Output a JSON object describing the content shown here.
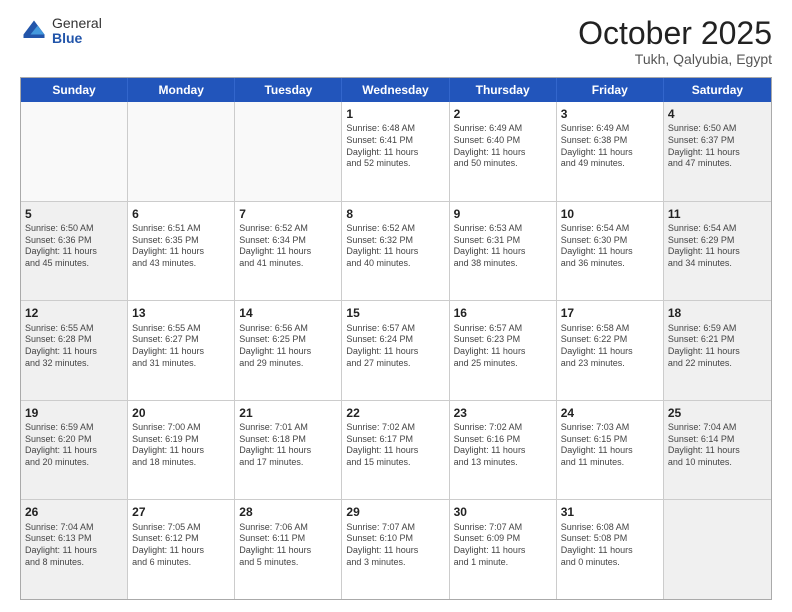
{
  "header": {
    "logo_general": "General",
    "logo_blue": "Blue",
    "month": "October 2025",
    "location": "Tukh, Qalyubia, Egypt"
  },
  "weekdays": [
    "Sunday",
    "Monday",
    "Tuesday",
    "Wednesday",
    "Thursday",
    "Friday",
    "Saturday"
  ],
  "rows": [
    [
      {
        "day": "",
        "text": "",
        "empty": true
      },
      {
        "day": "",
        "text": "",
        "empty": true
      },
      {
        "day": "",
        "text": "",
        "empty": true
      },
      {
        "day": "1",
        "text": "Sunrise: 6:48 AM\nSunset: 6:41 PM\nDaylight: 11 hours\nand 52 minutes.",
        "empty": false
      },
      {
        "day": "2",
        "text": "Sunrise: 6:49 AM\nSunset: 6:40 PM\nDaylight: 11 hours\nand 50 minutes.",
        "empty": false
      },
      {
        "day": "3",
        "text": "Sunrise: 6:49 AM\nSunset: 6:38 PM\nDaylight: 11 hours\nand 49 minutes.",
        "empty": false
      },
      {
        "day": "4",
        "text": "Sunrise: 6:50 AM\nSunset: 6:37 PM\nDaylight: 11 hours\nand 47 minutes.",
        "empty": false,
        "shaded": true
      }
    ],
    [
      {
        "day": "5",
        "text": "Sunrise: 6:50 AM\nSunset: 6:36 PM\nDaylight: 11 hours\nand 45 minutes.",
        "empty": false,
        "shaded": true
      },
      {
        "day": "6",
        "text": "Sunrise: 6:51 AM\nSunset: 6:35 PM\nDaylight: 11 hours\nand 43 minutes.",
        "empty": false
      },
      {
        "day": "7",
        "text": "Sunrise: 6:52 AM\nSunset: 6:34 PM\nDaylight: 11 hours\nand 41 minutes.",
        "empty": false
      },
      {
        "day": "8",
        "text": "Sunrise: 6:52 AM\nSunset: 6:32 PM\nDaylight: 11 hours\nand 40 minutes.",
        "empty": false
      },
      {
        "day": "9",
        "text": "Sunrise: 6:53 AM\nSunset: 6:31 PM\nDaylight: 11 hours\nand 38 minutes.",
        "empty": false
      },
      {
        "day": "10",
        "text": "Sunrise: 6:54 AM\nSunset: 6:30 PM\nDaylight: 11 hours\nand 36 minutes.",
        "empty": false
      },
      {
        "day": "11",
        "text": "Sunrise: 6:54 AM\nSunset: 6:29 PM\nDaylight: 11 hours\nand 34 minutes.",
        "empty": false,
        "shaded": true
      }
    ],
    [
      {
        "day": "12",
        "text": "Sunrise: 6:55 AM\nSunset: 6:28 PM\nDaylight: 11 hours\nand 32 minutes.",
        "empty": false,
        "shaded": true
      },
      {
        "day": "13",
        "text": "Sunrise: 6:55 AM\nSunset: 6:27 PM\nDaylight: 11 hours\nand 31 minutes.",
        "empty": false
      },
      {
        "day": "14",
        "text": "Sunrise: 6:56 AM\nSunset: 6:25 PM\nDaylight: 11 hours\nand 29 minutes.",
        "empty": false
      },
      {
        "day": "15",
        "text": "Sunrise: 6:57 AM\nSunset: 6:24 PM\nDaylight: 11 hours\nand 27 minutes.",
        "empty": false
      },
      {
        "day": "16",
        "text": "Sunrise: 6:57 AM\nSunset: 6:23 PM\nDaylight: 11 hours\nand 25 minutes.",
        "empty": false
      },
      {
        "day": "17",
        "text": "Sunrise: 6:58 AM\nSunset: 6:22 PM\nDaylight: 11 hours\nand 23 minutes.",
        "empty": false
      },
      {
        "day": "18",
        "text": "Sunrise: 6:59 AM\nSunset: 6:21 PM\nDaylight: 11 hours\nand 22 minutes.",
        "empty": false,
        "shaded": true
      }
    ],
    [
      {
        "day": "19",
        "text": "Sunrise: 6:59 AM\nSunset: 6:20 PM\nDaylight: 11 hours\nand 20 minutes.",
        "empty": false,
        "shaded": true
      },
      {
        "day": "20",
        "text": "Sunrise: 7:00 AM\nSunset: 6:19 PM\nDaylight: 11 hours\nand 18 minutes.",
        "empty": false
      },
      {
        "day": "21",
        "text": "Sunrise: 7:01 AM\nSunset: 6:18 PM\nDaylight: 11 hours\nand 17 minutes.",
        "empty": false
      },
      {
        "day": "22",
        "text": "Sunrise: 7:02 AM\nSunset: 6:17 PM\nDaylight: 11 hours\nand 15 minutes.",
        "empty": false
      },
      {
        "day": "23",
        "text": "Sunrise: 7:02 AM\nSunset: 6:16 PM\nDaylight: 11 hours\nand 13 minutes.",
        "empty": false
      },
      {
        "day": "24",
        "text": "Sunrise: 7:03 AM\nSunset: 6:15 PM\nDaylight: 11 hours\nand 11 minutes.",
        "empty": false
      },
      {
        "day": "25",
        "text": "Sunrise: 7:04 AM\nSunset: 6:14 PM\nDaylight: 11 hours\nand 10 minutes.",
        "empty": false,
        "shaded": true
      }
    ],
    [
      {
        "day": "26",
        "text": "Sunrise: 7:04 AM\nSunset: 6:13 PM\nDaylight: 11 hours\nand 8 minutes.",
        "empty": false,
        "shaded": true
      },
      {
        "day": "27",
        "text": "Sunrise: 7:05 AM\nSunset: 6:12 PM\nDaylight: 11 hours\nand 6 minutes.",
        "empty": false
      },
      {
        "day": "28",
        "text": "Sunrise: 7:06 AM\nSunset: 6:11 PM\nDaylight: 11 hours\nand 5 minutes.",
        "empty": false
      },
      {
        "day": "29",
        "text": "Sunrise: 7:07 AM\nSunset: 6:10 PM\nDaylight: 11 hours\nand 3 minutes.",
        "empty": false
      },
      {
        "day": "30",
        "text": "Sunrise: 7:07 AM\nSunset: 6:09 PM\nDaylight: 11 hours\nand 1 minute.",
        "empty": false
      },
      {
        "day": "31",
        "text": "Sunrise: 6:08 AM\nSunset: 5:08 PM\nDaylight: 11 hours\nand 0 minutes.",
        "empty": false
      },
      {
        "day": "",
        "text": "",
        "empty": true,
        "shaded": true
      }
    ]
  ]
}
